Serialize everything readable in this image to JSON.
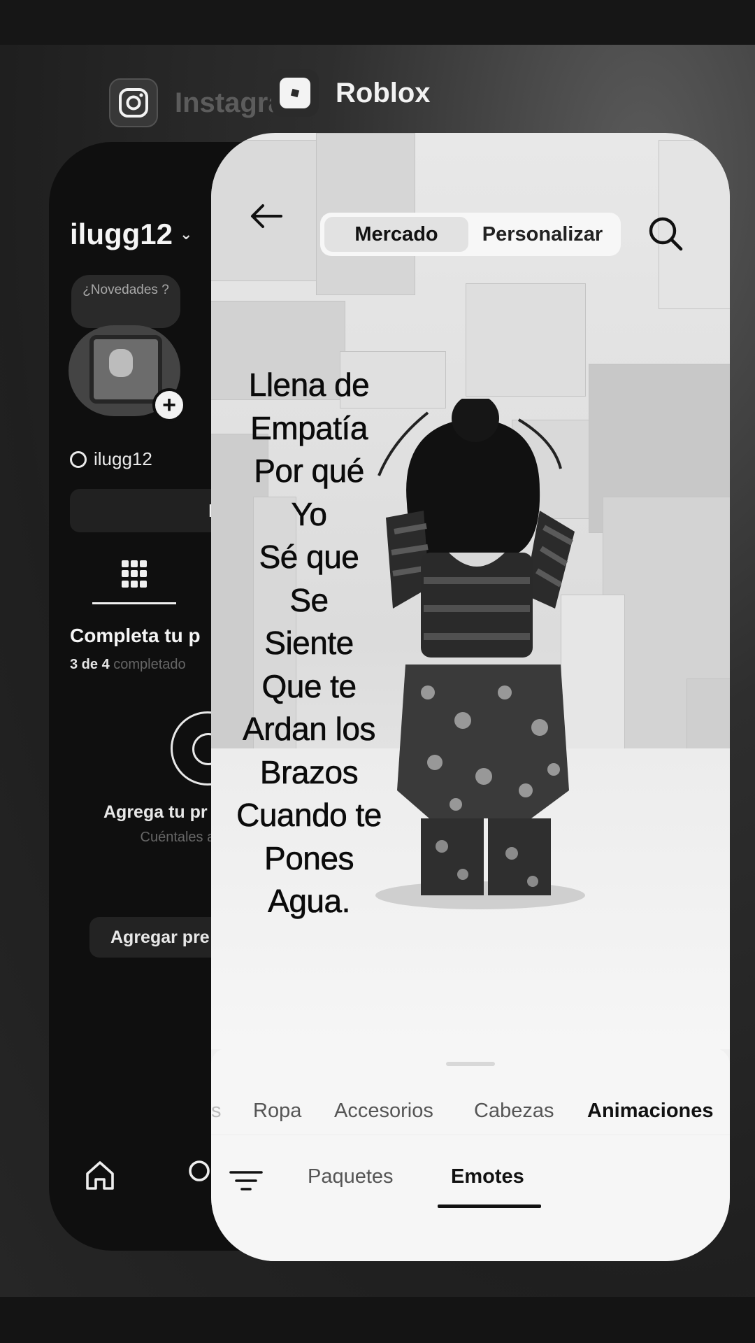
{
  "apps": {
    "instagram": {
      "label": "Instagram",
      "username": "ilugg12",
      "note_bubble": "¿Novedades ?",
      "threads_handle": "ilugg12",
      "edit_button": "Editar",
      "complete_title": "Completa tu p",
      "progress_count": "3 de 4",
      "progress_suffix": "completado",
      "add_title": "Agrega tu pr",
      "add_desc": "Cuéntales a tus s sobr",
      "add_button": "Agregar pre"
    },
    "roblox": {
      "label": "Roblox",
      "tabs": {
        "market": "Mercado",
        "customize": "Personalizar"
      },
      "overlay_lines": [
        "Llena de",
        "Empatía",
        "Por qué",
        "Yo",
        "Sé que",
        "Se",
        "Siente",
        "Que te",
        "Ardan los",
        "Brazos",
        "Cuando te",
        "Pones",
        "Agua."
      ],
      "categories": {
        "partial": "s",
        "clothing": "Ropa",
        "accessories": "Accesorios",
        "heads": "Cabezas",
        "animations": "Animaciones"
      },
      "subtabs": {
        "packages": "Paquetes",
        "emotes": "Emotes"
      }
    }
  },
  "icons": {
    "instagram": "instagram-icon",
    "roblox": "roblox-icon",
    "back": "arrow-left-icon",
    "search": "search-icon",
    "filter": "filter-icon",
    "home": "home-icon",
    "grid": "grid-icon"
  }
}
